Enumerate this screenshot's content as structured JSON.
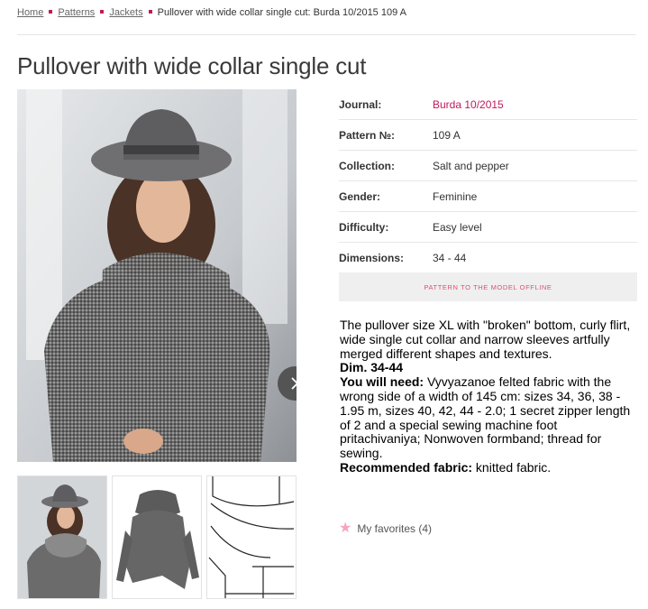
{
  "breadcrumb": {
    "home": "Home",
    "patterns": "Patterns",
    "jackets": "Jackets",
    "current": "Pullover with wide collar single cut: Burda 10/2015 109 A"
  },
  "title": "Pullover with wide collar single cut",
  "specs": [
    {
      "label": "Journal:",
      "value": "Burda 10/2015"
    },
    {
      "label": "Pattern №:",
      "value": "109 A"
    },
    {
      "label": "Collection:",
      "value": "Salt and pepper"
    },
    {
      "label": "Gender:",
      "value": "Feminine"
    },
    {
      "label": "Difficulty:",
      "value": "Easy level"
    },
    {
      "label": "Dimensions:",
      "value": "34 - 44"
    }
  ],
  "offline_button": "PATTERN TO THE MODEL OFFLINE",
  "description": {
    "intro": "The pullover size XL with \"broken\" bottom, curly flirt, wide single cut collar and narrow sleeves artfully merged different shapes and textures.",
    "dim": "Dim. 34-44",
    "need_label": "You will need:",
    "need_text": " Vyvyazanoe felted fabric with the wrong side of a width of 145 cm: sizes 34, 36, 38 - 1.95 m, sizes 40, 42, 44 - 2.0; 1 secret zipper length of 2 and a special sewing machine foot pritachivaniya; Nonwoven formband; thread for sewing.",
    "fabric_label": "Recommended fabric:",
    "fabric_text": " knitted fabric."
  },
  "favorites": "My favorites (4)",
  "colors": {
    "accent": "#c2185b",
    "button_text": "#d9536f",
    "star": "#f4a6bf"
  },
  "icons": {
    "next": "chevron-right-icon",
    "favorite": "star-icon"
  }
}
